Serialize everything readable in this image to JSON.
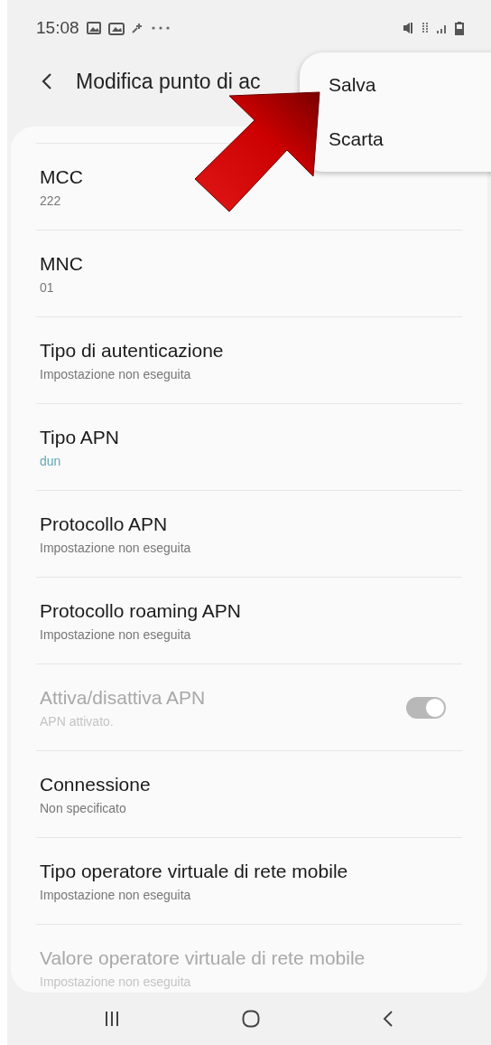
{
  "status_bar": {
    "time": "15:08"
  },
  "header": {
    "title": "Modifica punto di ac"
  },
  "popup_menu": {
    "items": [
      {
        "label": "Salva"
      },
      {
        "label": "Scarta"
      }
    ]
  },
  "settings": [
    {
      "kind": "text",
      "title": "MCC",
      "value": "222",
      "highlighted": false,
      "disabled": false
    },
    {
      "kind": "text",
      "title": "MNC",
      "value": "01",
      "highlighted": false,
      "disabled": false
    },
    {
      "kind": "text",
      "title": "Tipo di autenticazione",
      "value": "Impostazione non eseguita",
      "highlighted": false,
      "disabled": false
    },
    {
      "kind": "text",
      "title": "Tipo APN",
      "value": "dun",
      "highlighted": true,
      "disabled": false
    },
    {
      "kind": "text",
      "title": "Protocollo APN",
      "value": "Impostazione non eseguita",
      "highlighted": false,
      "disabled": false
    },
    {
      "kind": "text",
      "title": "Protocollo roaming APN",
      "value": "Impostazione non eseguita",
      "highlighted": false,
      "disabled": false
    },
    {
      "kind": "switch",
      "title": "Attiva/disattiva APN",
      "value": "APN attivato.",
      "highlighted": false,
      "disabled": true,
      "on": true
    },
    {
      "kind": "text",
      "title": "Connessione",
      "value": "Non specificato",
      "highlighted": false,
      "disabled": false
    },
    {
      "kind": "text",
      "title": "Tipo operatore virtuale di rete mobile",
      "value": "Impostazione non eseguita",
      "highlighted": false,
      "disabled": false
    },
    {
      "kind": "text",
      "title": "Valore operatore virtuale di rete mobile",
      "value": "Impostazione non eseguita",
      "highlighted": false,
      "disabled": true
    }
  ]
}
